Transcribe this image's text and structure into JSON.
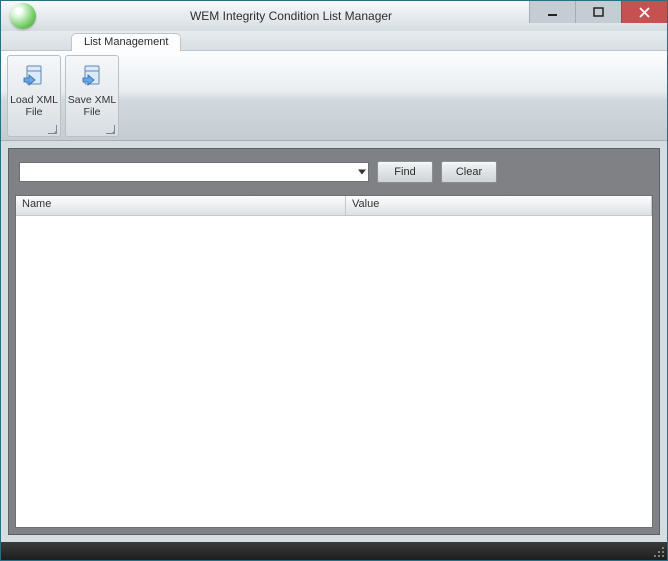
{
  "titlebar": {
    "title": "WEM Integrity Condition List Manager"
  },
  "tabs": [
    {
      "label": "List Management"
    }
  ],
  "ribbon": {
    "load_xml": {
      "line1": "Load XML",
      "line2": "File"
    },
    "save_xml": {
      "line1": "Save XML",
      "line2": "File"
    }
  },
  "search": {
    "combo_value": "",
    "find_label": "Find",
    "clear_label": "Clear"
  },
  "list": {
    "columns": {
      "name": "Name",
      "value": "Value"
    },
    "rows": []
  }
}
